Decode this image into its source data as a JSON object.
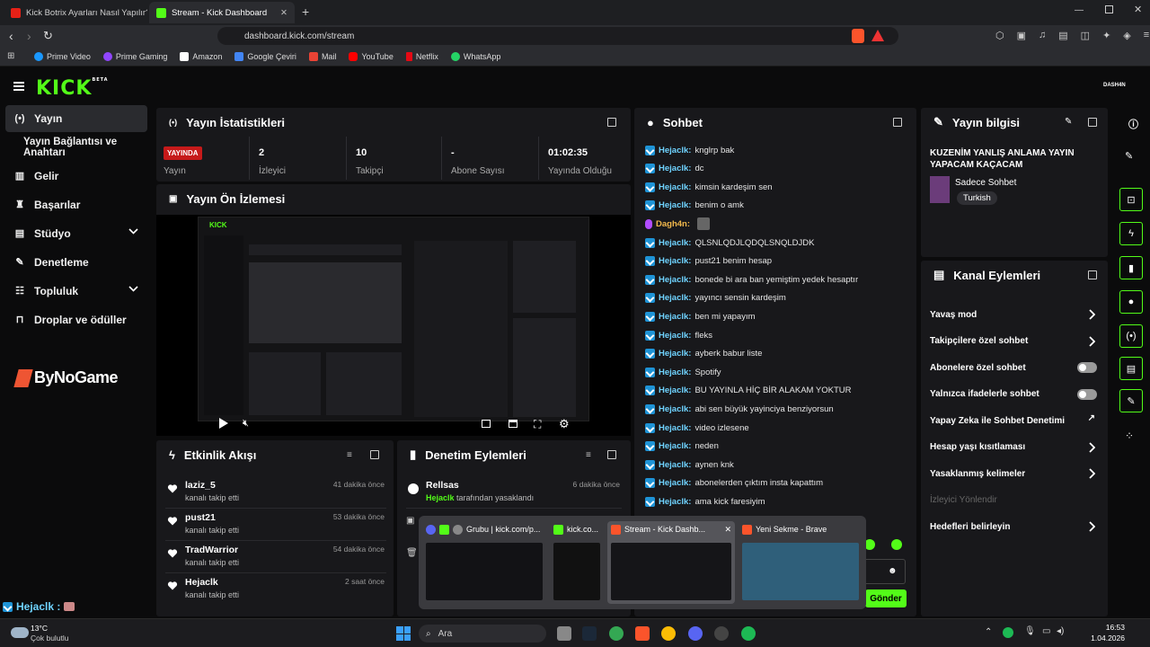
{
  "browser": {
    "tabs": [
      {
        "title": "Kick Botrix Ayarları Nasıl Yapılır? Takip"
      },
      {
        "title": "Stream - Kick Dashboard"
      }
    ],
    "new_tab": "+",
    "url": "dashboard.kick.com/stream",
    "bookmarks": [
      "Prime Video",
      "Prime Gaming",
      "Amazon",
      "Google Çeviri",
      "Mail",
      "YouTube",
      "Netflix",
      "WhatsApp"
    ]
  },
  "app": {
    "logo": "KICK",
    "logo_sup": "BETA",
    "user_badge": "DASH4N"
  },
  "sidebar": {
    "items": [
      {
        "label": "Yayın",
        "icon": "broadcast-icon"
      },
      {
        "label": "Yayın Bağlantısı ve Anahtarı"
      },
      {
        "label": "Gelir",
        "icon": "chart-icon"
      },
      {
        "label": "Başarılar",
        "icon": "trophy-icon"
      },
      {
        "label": "Stüdyo",
        "icon": "studio-icon"
      },
      {
        "label": "Denetleme",
        "icon": "wrench-icon"
      },
      {
        "label": "Topluluk",
        "icon": "people-icon"
      },
      {
        "label": "Droplar ve ödüller",
        "icon": "gift-icon"
      }
    ],
    "sponsor": "ByNoGame"
  },
  "stats": {
    "title": "Yayın İstatistikleri",
    "live_badge": "YAYINDA",
    "cells": [
      {
        "value": "",
        "label": "Yayın"
      },
      {
        "value": "2",
        "label": "İzleyici"
      },
      {
        "value": "10",
        "label": "Takipçi"
      },
      {
        "value": "-",
        "label": "Abone Sayısı"
      },
      {
        "value": "01:02:35",
        "label": "Yayında Olduğu"
      }
    ]
  },
  "preview": {
    "title": "Yayın Ön İzlemesi"
  },
  "activity": {
    "title": "Etkinlik Akışı",
    "items": [
      {
        "name": "laziz_5",
        "sub": "kanalı takip etti",
        "time": "41 dakika önce"
      },
      {
        "name": "pust21",
        "sub": "kanalı takip etti",
        "time": "53 dakika önce"
      },
      {
        "name": "TradWarrior",
        "sub": "kanalı takip etti",
        "time": "54 dakika önce"
      },
      {
        "name": "Hejaclk",
        "sub": "kanalı takip etti",
        "time": "2 saat önce"
      }
    ]
  },
  "moderation": {
    "title": "Denetim Eylemleri",
    "items": [
      {
        "name": "Rellsas",
        "by": "Hejaclk",
        "sub": "tarafından yasaklandı",
        "time": "6 dakika önce"
      }
    ]
  },
  "chat": {
    "title": "Sohbet",
    "messages": [
      {
        "user": "Hejaclk",
        "text": "knglrp bak"
      },
      {
        "user": "Hejaclk",
        "text": "dc"
      },
      {
        "user": "Hejaclk",
        "text": "kimsin kardeşim sen"
      },
      {
        "user": "Hejaclk",
        "text": "benim o amk"
      },
      {
        "user": "Dagh4n",
        "text": ""
      },
      {
        "user": "Hejaclk",
        "text": "QLSNLQDJLQDQLSNQLDJDK"
      },
      {
        "user": "Hejaclk",
        "text": "pust21 benim hesap"
      },
      {
        "user": "Hejaclk",
        "text": "bonede bi ara ban yemiştim yedek hesaptır"
      },
      {
        "user": "Hejaclk",
        "text": "yayıncı sensin kardeşim"
      },
      {
        "user": "Hejaclk",
        "text": "ben mi yapayım"
      },
      {
        "user": "Hejaclk",
        "text": "fleks"
      },
      {
        "user": "Hejaclk",
        "text": "ayberk babur liste"
      },
      {
        "user": "Hejaclk",
        "text": "Spotify"
      },
      {
        "user": "Hejaclk",
        "text": "BU YAYINLA HİÇ BİR ALAKAM YOKTUR"
      },
      {
        "user": "Hejaclk",
        "text": "abi sen büyük yayinciya benziyorsun"
      },
      {
        "user": "Hejaclk",
        "text": "video izlesene"
      },
      {
        "user": "Hejaclk",
        "text": "neden"
      },
      {
        "user": "Hejaclk",
        "text": "aynen knk"
      },
      {
        "user": "Hejaclk",
        "text": "abonelerden çıktım insta kapattım"
      },
      {
        "user": "Hejaclk",
        "text": "ama kick faresiyim"
      }
    ],
    "send_label": "Gönder"
  },
  "stream_info": {
    "title": "Yayın bilgisi",
    "stream_title": "KUZENİM YANLIŞ ANLAMA YAYIN YAPACAM KAÇACAM",
    "category": "Sadece Sohbet",
    "language": "Turkish"
  },
  "channel_actions": {
    "title": "Kanal Eylemleri",
    "items": [
      {
        "label": "Yavaş mod",
        "kind": "arrow"
      },
      {
        "label": "Takipçilere özel sohbet",
        "kind": "arrow"
      },
      {
        "label": "Abonelere özel sohbet",
        "kind": "toggle"
      },
      {
        "label": "Yalnızca ifadelerle sohbet",
        "kind": "toggle"
      },
      {
        "label": "Yapay Zeka ile Sohbet Denetimi",
        "kind": "external"
      },
      {
        "label": "Hesap yaşı kısıtlaması",
        "kind": "arrow"
      },
      {
        "label": "Yasaklanmış kelimeler",
        "kind": "arrow"
      },
      {
        "label": "İzleyici Yönlendir",
        "kind": "disabled"
      },
      {
        "label": "Hedefleri belirleyin",
        "kind": "arrow"
      }
    ]
  },
  "bottom_left": {
    "text": "Hejaclk :"
  },
  "switcher": {
    "windows": [
      {
        "title": "Grubu | kick.com/p..."
      },
      {
        "title": "kick.co..."
      },
      {
        "title": "Stream - Kick Dashb..."
      },
      {
        "title": "Yeni Sekme - Brave"
      }
    ]
  },
  "taskbar": {
    "weather_temp": "13°C",
    "weather_desc": "Çok bulutlu",
    "search": "Ara",
    "time": "16:53",
    "date": "1.04.2026"
  }
}
